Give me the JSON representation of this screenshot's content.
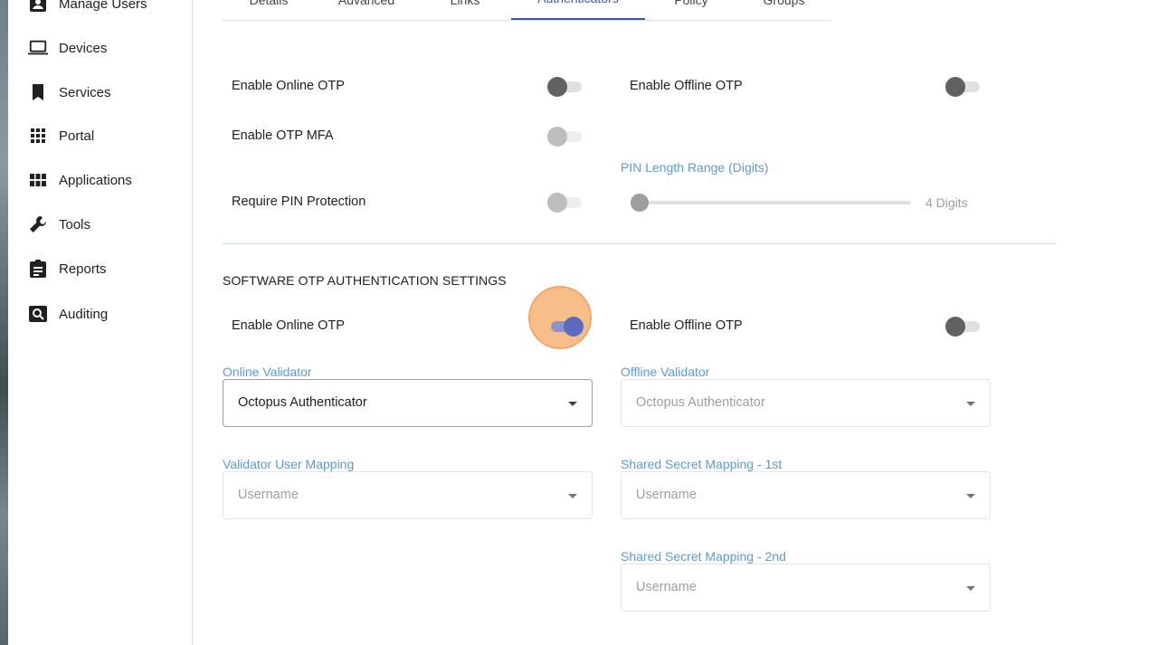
{
  "sidebar": {
    "items": [
      {
        "label": "Manage Users",
        "icon": "account-box-icon"
      },
      {
        "label": "Devices",
        "icon": "laptop-icon"
      },
      {
        "label": "Services",
        "icon": "bookmark-icon"
      },
      {
        "label": "Portal",
        "icon": "apps-grid-icon"
      },
      {
        "label": "Applications",
        "icon": "view-module-icon"
      },
      {
        "label": "Tools",
        "icon": "wrench-icon"
      },
      {
        "label": "Reports",
        "icon": "clipboard-icon"
      },
      {
        "label": "Auditing",
        "icon": "search-box-icon"
      }
    ]
  },
  "tabs": [
    {
      "label": "Details"
    },
    {
      "label": "Advanced"
    },
    {
      "label": "Links"
    },
    {
      "label": "Authenticators",
      "active": true
    },
    {
      "label": "Policy"
    },
    {
      "label": "Groups"
    }
  ],
  "hardware": {
    "enable_online_otp": {
      "label": "Enable Online OTP",
      "on": false
    },
    "enable_offline_otp": {
      "label": "Enable Offline OTP",
      "on": false
    },
    "enable_otp_mfa": {
      "label": "Enable OTP MFA",
      "on": false,
      "disabled": true
    },
    "pin_length": {
      "label": "PIN Length Range (Digits)",
      "value_text": "4 Digits",
      "fraction": 0.0
    },
    "require_pin": {
      "label": "Require PIN Protection",
      "on": false,
      "disabled": true
    }
  },
  "software": {
    "title": "SOFTWARE OTP AUTHENTICATION SETTINGS",
    "enable_online_otp": {
      "label": "Enable Online OTP",
      "on": true
    },
    "enable_offline_otp": {
      "label": "Enable Offline OTP",
      "on": false
    },
    "online_validator": {
      "label": "Online Validator",
      "value": "Octopus Authenticator"
    },
    "offline_validator": {
      "label": "Offline Validator",
      "value": "Octopus Authenticator"
    },
    "validator_user_mapping": {
      "label": "Validator User Mapping",
      "value": "Username"
    },
    "shared_secret_1": {
      "label": "Shared Secret Mapping - 1st",
      "value": "Username"
    },
    "shared_secret_2": {
      "label": "Shared Secret Mapping - 2nd",
      "value": "Username"
    }
  },
  "colors": {
    "accent": "#3f51b5",
    "label_blue": "#5b9bd5",
    "focus": "#f5a862"
  }
}
